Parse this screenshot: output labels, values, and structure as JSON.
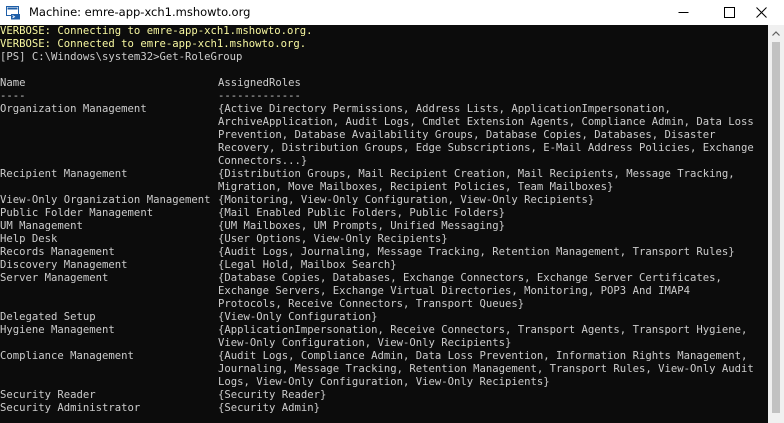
{
  "window": {
    "title": "Machine: emre-app-xch1.mshowto.org",
    "icons": {
      "app": "powershell-machine-icon",
      "minimize": "minimize-icon",
      "maximize": "maximize-icon",
      "close": "close-icon",
      "scroll_up": "scroll-up-arrow-icon"
    }
  },
  "colors": {
    "console_bg": "#0c0c0c",
    "console_text": "#cccccc",
    "verbose_text": "#f7f7a0"
  },
  "console": {
    "verbose": [
      "VERBOSE: Connecting to emre-app-xch1.mshowto.org.",
      "VERBOSE: Connected to emre-app-xch1.mshowto.org."
    ],
    "prompt": "[PS] C:\\Windows\\system32>",
    "command": "Get-RoleGroup",
    "headers": {
      "name": "Name",
      "roles": "AssignedRoles"
    },
    "underlines": {
      "name": "----",
      "roles": "-------------"
    },
    "rows": [
      {
        "name": "Organization Management",
        "roles": [
          "{Active Directory Permissions, Address Lists, ApplicationImpersonation,",
          "ArchiveApplication, Audit Logs, Cmdlet Extension Agents, Compliance Admin, Data Loss",
          "Prevention, Database Availability Groups, Database Copies, Databases, Disaster",
          "Recovery, Distribution Groups, Edge Subscriptions, E-Mail Address Policies, Exchange",
          "Connectors...}"
        ]
      },
      {
        "name": "Recipient Management",
        "roles": [
          "{Distribution Groups, Mail Recipient Creation, Mail Recipients, Message Tracking,",
          "Migration, Move Mailboxes, Recipient Policies, Team Mailboxes}"
        ]
      },
      {
        "name": "View-Only Organization Management",
        "roles": [
          "{Monitoring, View-Only Configuration, View-Only Recipients}"
        ]
      },
      {
        "name": "Public Folder Management",
        "roles": [
          "{Mail Enabled Public Folders, Public Folders}"
        ]
      },
      {
        "name": "UM Management",
        "roles": [
          "{UM Mailboxes, UM Prompts, Unified Messaging}"
        ]
      },
      {
        "name": "Help Desk",
        "roles": [
          "{User Options, View-Only Recipients}"
        ]
      },
      {
        "name": "Records Management",
        "roles": [
          "{Audit Logs, Journaling, Message Tracking, Retention Management, Transport Rules}"
        ]
      },
      {
        "name": "Discovery Management",
        "roles": [
          "{Legal Hold, Mailbox Search}"
        ]
      },
      {
        "name": "Server Management",
        "roles": [
          "{Database Copies, Databases, Exchange Connectors, Exchange Server Certificates,",
          "Exchange Servers, Exchange Virtual Directories, Monitoring, POP3 And IMAP4",
          "Protocols, Receive Connectors, Transport Queues}"
        ]
      },
      {
        "name": "Delegated Setup",
        "roles": [
          "{View-Only Configuration}"
        ]
      },
      {
        "name": "Hygiene Management",
        "roles": [
          "{ApplicationImpersonation, Receive Connectors, Transport Agents, Transport Hygiene,",
          "View-Only Configuration, View-Only Recipients}"
        ]
      },
      {
        "name": "Compliance Management",
        "roles": [
          "{Audit Logs, Compliance Admin, Data Loss Prevention, Information Rights Management,",
          "Journaling, Message Tracking, Retention Management, Transport Rules, View-Only Audit",
          "Logs, View-Only Configuration, View-Only Recipients}"
        ]
      },
      {
        "name": "Security Reader",
        "roles": [
          "{Security Reader}"
        ]
      },
      {
        "name": "Security Administrator",
        "roles": [
          "{Security Admin}"
        ]
      }
    ]
  }
}
